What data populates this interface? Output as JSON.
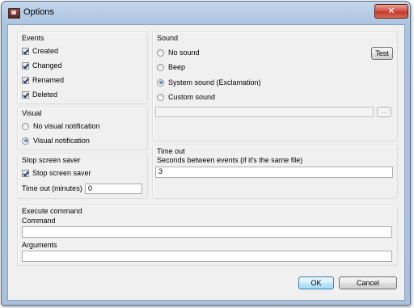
{
  "window": {
    "title": "Options",
    "close_glyph": "✕",
    "app_icon": "app-icon"
  },
  "events": {
    "legend": "Events",
    "items": [
      {
        "label": "Created",
        "checked": true
      },
      {
        "label": "Changed",
        "checked": true
      },
      {
        "label": "Renamed",
        "checked": true
      },
      {
        "label": "Deleted",
        "checked": true
      }
    ]
  },
  "visual": {
    "legend": "Visual",
    "options": [
      {
        "label": "No visual notification",
        "selected": false
      },
      {
        "label": "Visual notification",
        "selected": true
      }
    ]
  },
  "screensaver": {
    "legend": "Stop screen saver",
    "checkbox_label": "Stop screen saver",
    "checked": true,
    "timeout_label": "Time out (minutes)",
    "timeout_value": "0"
  },
  "sound": {
    "legend": "Sound",
    "options": [
      {
        "label": "No sound",
        "selected": false
      },
      {
        "label": "Beep",
        "selected": false
      },
      {
        "label": "System sound (Exclamation)",
        "selected": true
      },
      {
        "label": "Custom sound",
        "selected": false
      }
    ],
    "test_button": "Test",
    "custom_path": "",
    "browse_button": "..."
  },
  "timeout": {
    "legend": "Time out",
    "field_label": "Seconds between events (if it's the same file)",
    "value": "3"
  },
  "execute": {
    "legend": "Execute command",
    "command_label": "Command",
    "command_value": "",
    "arguments_label": "Arguments",
    "arguments_value": ""
  },
  "buttons": {
    "ok": "OK",
    "cancel": "Cancel"
  }
}
